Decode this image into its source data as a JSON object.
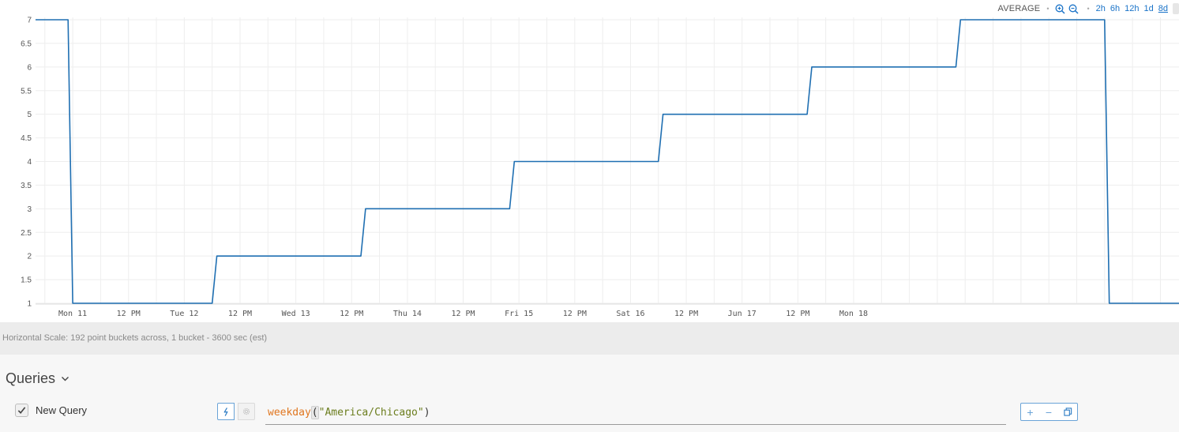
{
  "toolbar": {
    "summary_label": "AVERAGE",
    "separator": "•",
    "zoom_in_icon": "zoom-in-icon",
    "zoom_out_icon": "zoom-out-icon",
    "ranges": [
      "2h",
      "6h",
      "12h",
      "1d",
      "8d"
    ],
    "active_range": "8d"
  },
  "chart_data": {
    "type": "line",
    "step": true,
    "series": [
      {
        "color": "#1f6fb2",
        "points": [
          [
            0,
            7
          ],
          [
            7,
            7
          ],
          [
            8,
            1
          ],
          [
            38,
            1
          ],
          [
            39,
            2
          ],
          [
            70,
            2
          ],
          [
            71,
            3
          ],
          [
            102,
            3
          ],
          [
            103,
            4
          ],
          [
            134,
            4
          ],
          [
            135,
            5
          ],
          [
            166,
            5
          ],
          [
            167,
            6
          ],
          [
            198,
            6
          ],
          [
            199,
            7
          ],
          [
            230,
            7
          ],
          [
            231,
            1
          ],
          [
            246,
            1
          ]
        ]
      }
    ],
    "x_unit": "hours (1 bucket = 3600 sec)",
    "x_range": [
      0,
      246
    ],
    "ylim": [
      1,
      7
    ],
    "yticks": [
      "1",
      "1.5",
      "2",
      "2.5",
      "3",
      "3.5",
      "4",
      "4.5",
      "5",
      "5.5",
      "6",
      "6.5",
      "7"
    ],
    "xticks": [
      {
        "label": "Mon 11",
        "hour": 8
      },
      {
        "label": "12 PM",
        "hour": 20
      },
      {
        "label": "Tue 12",
        "hour": 32
      },
      {
        "label": "12 PM",
        "hour": 44
      },
      {
        "label": "Wed 13",
        "hour": 56
      },
      {
        "label": "12 PM",
        "hour": 68
      },
      {
        "label": "Thu 14",
        "hour": 80
      },
      {
        "label": "12 PM",
        "hour": 92
      },
      {
        "label": "Fri 15",
        "hour": 104
      },
      {
        "label": "12 PM",
        "hour": 116
      },
      {
        "label": "Sat 16",
        "hour": 128
      },
      {
        "label": "12 PM",
        "hour": 140
      },
      {
        "label": "Jun 17",
        "hour": 152
      },
      {
        "label": "12 PM",
        "hour": 164
      },
      {
        "label": "Mon 18",
        "hour": 176
      }
    ],
    "grid": true
  },
  "scale_note": "Horizontal Scale: 192 point buckets across, 1 bucket - 3600 sec (est)",
  "queries": {
    "header": "Queries",
    "items": [
      {
        "name": "New Query",
        "checked": true,
        "expression": {
          "function": "weekday",
          "open_paren": "(",
          "argument": "\"America/Chicago\"",
          "close_paren": ")"
        }
      }
    ],
    "actions": {
      "add": "+",
      "remove": "−",
      "copy_icon": "copy-icon"
    }
  }
}
